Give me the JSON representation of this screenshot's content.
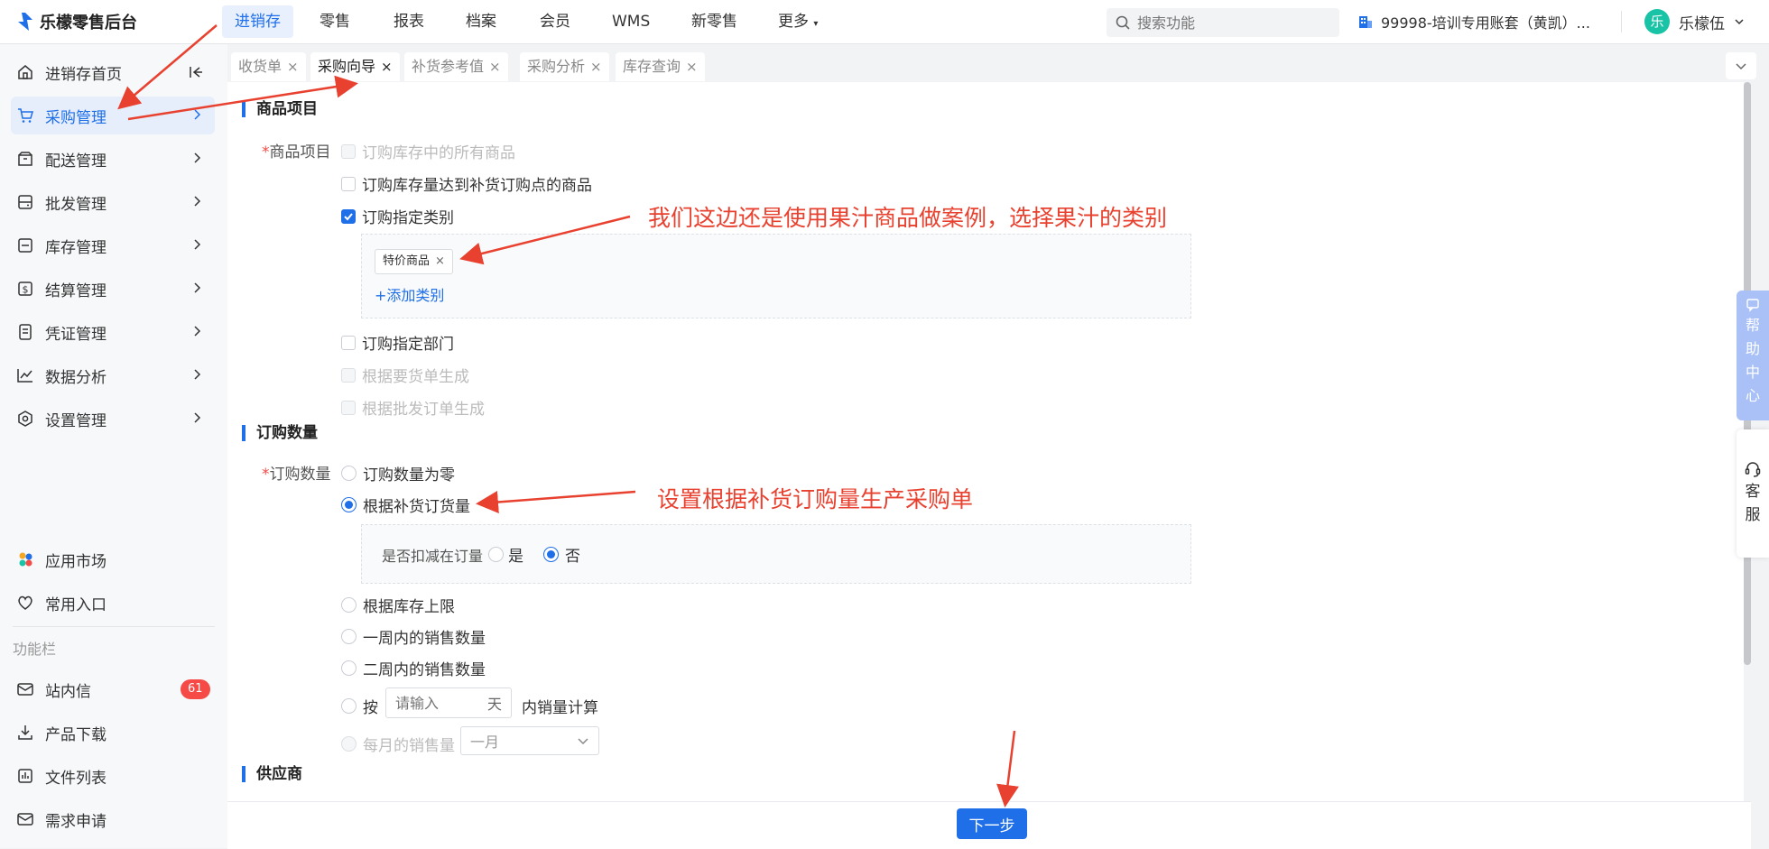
{
  "app": {
    "title": "乐檬零售后台"
  },
  "topnav": [
    "进销存",
    "零售",
    "报表",
    "档案",
    "会员",
    "WMS",
    "新零售",
    "更多"
  ],
  "search": {
    "placeholder": "搜索功能"
  },
  "account": {
    "label": "99998-培训专用账套（黄凯）..."
  },
  "user": {
    "avatar_char": "乐",
    "name": "乐檬伍"
  },
  "sidebar": {
    "items": [
      "进销存首页",
      "采购管理",
      "配送管理",
      "批发管理",
      "库存管理",
      "结算管理",
      "凭证管理",
      "数据分析",
      "设置管理"
    ],
    "bottom": [
      "应用市场",
      "常用入口"
    ],
    "group_label": "功能栏",
    "tools": [
      "站内信",
      "产品下载",
      "文件列表",
      "需求申请"
    ],
    "badge": "61"
  },
  "tabs": [
    "收货单",
    "采购向导",
    "补货参考值",
    "采购分析",
    "库存查询"
  ],
  "form": {
    "sec1": "商品项目",
    "label1": "商品项目",
    "opts1": [
      "订购库存中的所有商品",
      "订购库存量达到补货订购点的商品",
      "订购指定类别"
    ],
    "tag": "特价商品",
    "add_cat": "+添加类别",
    "opts1b": [
      "订购指定部门",
      "根据要货单生成",
      "根据批发订单生成"
    ],
    "sec2": "订购数量",
    "label2": "订购数量",
    "opts2": [
      "订购数量为零",
      "根据补货订货量"
    ],
    "deduct_label": "是否扣减在订量",
    "yes": "是",
    "no": "否",
    "opts2b": [
      "根据库存上限",
      "一周内的销售数量",
      "二周内的销售数量"
    ],
    "by_label": "按",
    "input_placeholder": "请输入",
    "day_unit": "天",
    "calc_label": "内销量计算",
    "monthly_label": "每月的销售量",
    "month_value": "一月",
    "sec3": "供应商"
  },
  "footer": {
    "next": "下一步"
  },
  "right": {
    "help": [
      "帮",
      "助",
      "中",
      "心"
    ],
    "cs": [
      "客",
      "服"
    ]
  },
  "annotations": [
    "我们这边还是使用果汁商品做案例，选择果汁的类别",
    "设置根据补货订购量生产采购单"
  ],
  "colors": {
    "primary": "#1f6fe8",
    "annotation": "#e8412f",
    "badge": "#f54a45"
  }
}
